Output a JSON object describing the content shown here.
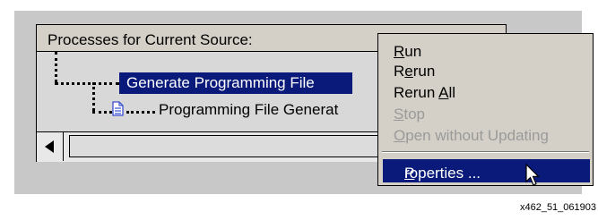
{
  "header": {
    "title": "Processes for Current Source:"
  },
  "tree": {
    "nodes": [
      {
        "label": "Generate Programming File"
      },
      {
        "label": "Programming File Generat"
      }
    ]
  },
  "menu": {
    "items": [
      {
        "label": "Run",
        "mnemonic": "R",
        "rest": "un",
        "pre": "",
        "disabled": false
      },
      {
        "label": "Rerun",
        "pre": "R",
        "mnemonic": "e",
        "rest": "run",
        "disabled": false
      },
      {
        "label": "Rerun All",
        "pre": "Rerun ",
        "mnemonic": "A",
        "rest": "ll",
        "disabled": false
      },
      {
        "label": "Stop",
        "pre": "",
        "mnemonic": "S",
        "rest": "top",
        "disabled": true
      },
      {
        "label": "Open without Updating",
        "pre": "",
        "mnemonic": "O",
        "rest": "pen without Updating",
        "disabled": true
      },
      {
        "label": "Properties ...",
        "pre": "",
        "mnemonic": "P",
        "rest": "roperties ...",
        "disabled": false,
        "selected": true
      }
    ]
  },
  "caption": "x462_51_061903",
  "colors": {
    "selection": "#0a1a7a",
    "panel": "#c8c8c8",
    "disabled_text": "#9a9a9a"
  }
}
